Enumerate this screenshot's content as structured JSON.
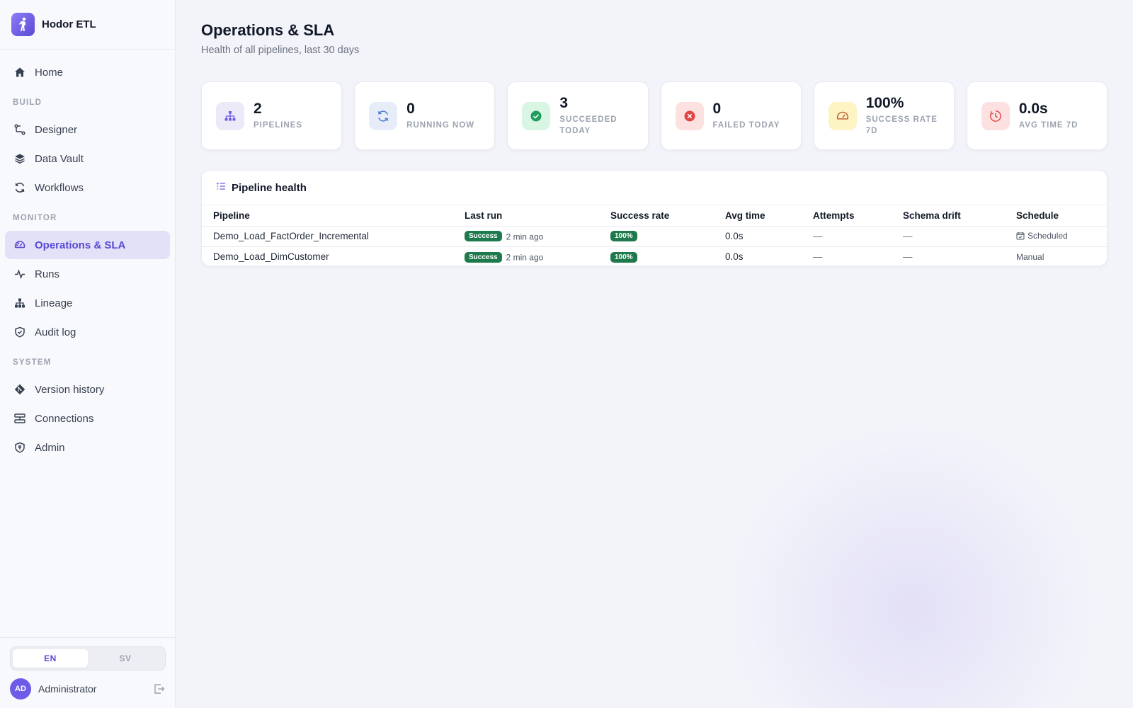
{
  "app": {
    "name": "Hodor ETL"
  },
  "sidebar": {
    "home": {
      "label": "Home",
      "icon": "home-icon"
    },
    "sections": {
      "build": "BUILD",
      "monitor": "MONITOR",
      "system": "SYSTEM"
    },
    "build_items": [
      {
        "label": "Designer",
        "icon": "designer-icon"
      },
      {
        "label": "Data Vault",
        "icon": "layers-icon"
      },
      {
        "label": "Workflows",
        "icon": "refresh-icon"
      }
    ],
    "monitor_items": [
      {
        "label": "Operations & SLA",
        "icon": "gauge-icon",
        "active": true
      },
      {
        "label": "Runs",
        "icon": "activity-icon"
      },
      {
        "label": "Lineage",
        "icon": "lineage-icon"
      },
      {
        "label": "Audit log",
        "icon": "shield-check-icon"
      }
    ],
    "system_items": [
      {
        "label": "Version history",
        "icon": "git-icon"
      },
      {
        "label": "Connections",
        "icon": "connections-icon"
      },
      {
        "label": "Admin",
        "icon": "shield-admin-icon"
      }
    ],
    "languages": [
      "EN",
      "SV"
    ],
    "active_language": "EN",
    "user": {
      "initials": "AD",
      "name": "Administrator"
    }
  },
  "page": {
    "title": "Operations & SLA",
    "subtitle": "Health of all pipelines, last 30 days"
  },
  "stats": [
    {
      "value": "2",
      "label": "PIPELINES",
      "icon": "pipelines-icon",
      "bg": "#eceaf9",
      "fg": "#6c5ce7"
    },
    {
      "value": "0",
      "label": "RUNNING NOW",
      "icon": "refresh-icon",
      "bg": "#e7edf8",
      "fg": "#4b7bd4"
    },
    {
      "value": "3",
      "label": "SUCCEEDED TODAY",
      "icon": "check-circle-icon",
      "bg": "#d9f5e4",
      "fg": "#1e9e5a"
    },
    {
      "value": "0",
      "label": "FAILED TODAY",
      "icon": "x-circle-icon",
      "bg": "#fde0e0",
      "fg": "#e04545"
    },
    {
      "value": "100%",
      "label": "SUCCESS RATE 7D",
      "icon": "gauge-icon",
      "bg": "#fdf4c4",
      "fg": "#c0552b"
    },
    {
      "value": "0.0s",
      "label": "AVG TIME 7D",
      "icon": "clock-icon",
      "bg": "#fde0e0",
      "fg": "#e04545"
    }
  ],
  "pipeline_health": {
    "title": "Pipeline health",
    "columns": [
      "Pipeline",
      "Last run",
      "Success rate",
      "Avg time",
      "Attempts",
      "Schema drift",
      "Schedule"
    ],
    "rows": [
      {
        "pipeline": "Demo_Load_FactOrder_Incremental",
        "status": "Success",
        "last_run": "2 min ago",
        "success_rate": "100%",
        "avg_time": "0.0s",
        "attempts": "—",
        "schema_drift": "—",
        "schedule": "Scheduled",
        "schedule_icon": "calendar-check-icon"
      },
      {
        "pipeline": "Demo_Load_DimCustomer",
        "status": "Success",
        "last_run": "2 min ago",
        "success_rate": "100%",
        "avg_time": "0.0s",
        "attempts": "—",
        "schema_drift": "—",
        "schedule": "Manual",
        "schedule_icon": ""
      }
    ]
  },
  "colors": {
    "accent": "#6c5ce7",
    "active_nav_bg": "#e2e1f7",
    "success_badge": "#1e7a4c"
  }
}
